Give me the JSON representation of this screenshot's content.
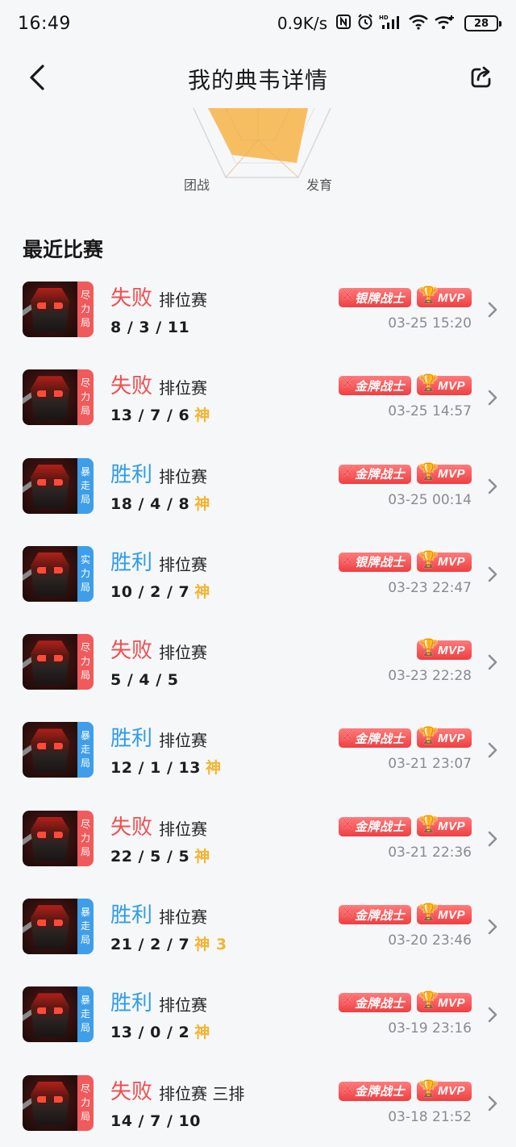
{
  "status_bar": {
    "time": "16:49",
    "net_speed": "0.9K/s",
    "battery": "28"
  },
  "header": {
    "title": "我的典韦详情"
  },
  "radar": {
    "labels": {
      "bottom_left": "团战",
      "bottom_right": "发育"
    },
    "fill_color": "#f7bb58"
  },
  "section": {
    "title": "最近比赛"
  },
  "matches": [
    {
      "mode": "尽力局",
      "mode_color": "red",
      "result": "失败",
      "outcome": "lose",
      "type": "排位赛",
      "kda": "8 / 3 / 11",
      "god": "",
      "badge": "银牌战士",
      "mvp": "MVP",
      "time": "03-25 15:20"
    },
    {
      "mode": "尽力局",
      "mode_color": "red",
      "result": "失败",
      "outcome": "lose",
      "type": "排位赛",
      "kda": "13 / 7 / 6",
      "god": "神",
      "badge": "金牌战士",
      "mvp": "MVP",
      "time": "03-25 14:57"
    },
    {
      "mode": "暴走局",
      "mode_color": "blue",
      "result": "胜利",
      "outcome": "win",
      "type": "排位赛",
      "kda": "18 / 4 / 8",
      "god": "神",
      "badge": "金牌战士",
      "mvp": "MVP",
      "time": "03-25 00:14"
    },
    {
      "mode": "实力局",
      "mode_color": "blue",
      "result": "胜利",
      "outcome": "win",
      "type": "排位赛",
      "kda": "10 / 2 / 7",
      "god": "神",
      "badge": "银牌战士",
      "mvp": "MVP",
      "time": "03-23 22:47"
    },
    {
      "mode": "尽力局",
      "mode_color": "red",
      "result": "失败",
      "outcome": "lose",
      "type": "排位赛",
      "kda": "5 / 4 / 5",
      "god": "",
      "badge": "",
      "mvp": "MVP",
      "time": "03-23 22:28"
    },
    {
      "mode": "暴走局",
      "mode_color": "blue",
      "result": "胜利",
      "outcome": "win",
      "type": "排位赛",
      "kda": "12 / 1 / 13",
      "god": "神",
      "badge": "金牌战士",
      "mvp": "MVP",
      "time": "03-21 23:07"
    },
    {
      "mode": "尽力局",
      "mode_color": "red",
      "result": "失败",
      "outcome": "lose",
      "type": "排位赛",
      "kda": "22 / 5 / 5",
      "god": "神",
      "badge": "金牌战士",
      "mvp": "MVP",
      "time": "03-21 22:36"
    },
    {
      "mode": "暴走局",
      "mode_color": "blue",
      "result": "胜利",
      "outcome": "win",
      "type": "排位赛",
      "kda": "21 / 2 / 7",
      "god": "神 3",
      "badge": "金牌战士",
      "mvp": "MVP",
      "time": "03-20 23:46"
    },
    {
      "mode": "暴走局",
      "mode_color": "blue",
      "result": "胜利",
      "outcome": "win",
      "type": "排位赛",
      "kda": "13 / 0 / 2",
      "god": "神",
      "badge": "金牌战士",
      "mvp": "MVP",
      "time": "03-19 23:16"
    },
    {
      "mode": "尽力局",
      "mode_color": "red",
      "result": "失败",
      "outcome": "lose",
      "type": "排位赛 三排",
      "kda": "14 / 7 / 10",
      "god": "",
      "badge": "金牌战士",
      "mvp": "MVP",
      "time": "03-18 21:52"
    }
  ]
}
